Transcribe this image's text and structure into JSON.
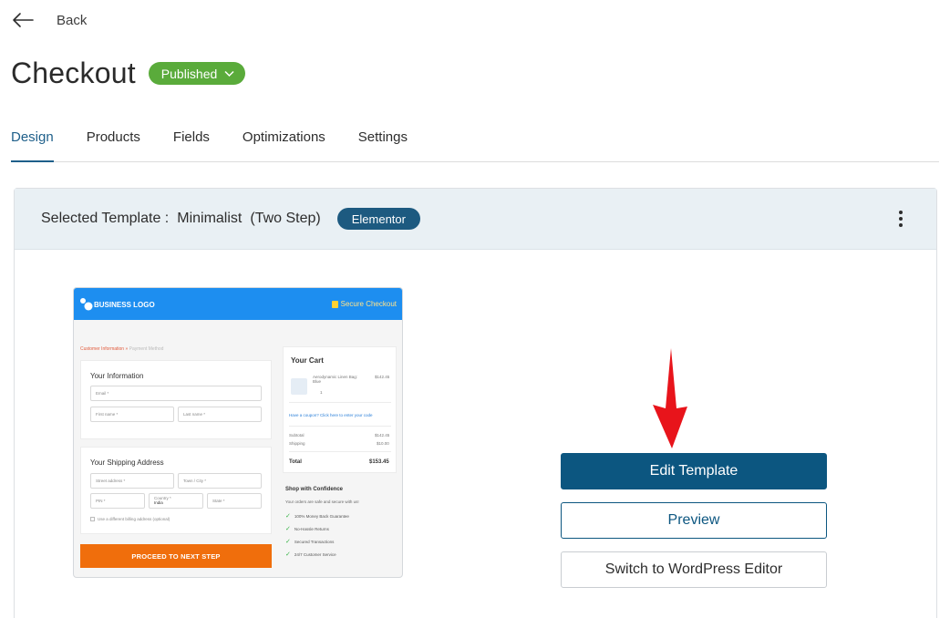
{
  "nav": {
    "back_label": "Back",
    "back_icon": "arrow-left-icon"
  },
  "page": {
    "title": "Checkout",
    "status": "Published",
    "status_color": "#5aab3b"
  },
  "tabs": [
    {
      "label": "Design",
      "active": true
    },
    {
      "label": "Products",
      "active": false
    },
    {
      "label": "Fields",
      "active": false
    },
    {
      "label": "Optimizations",
      "active": false
    },
    {
      "label": "Settings",
      "active": false
    }
  ],
  "template_card": {
    "selected_label": "Selected Template :",
    "template_name": "Minimalist",
    "template_variant": "(Two Step)",
    "builder_badge": "Elementor",
    "menu_icon": "kebab-menu-icon"
  },
  "thumbnail": {
    "logo": "BUSINESS LOGO",
    "secure": "Secure Checkout",
    "breadcrumb_current": "Customer Information",
    "breadcrumb_sep": "»",
    "breadcrumb_next": "Payment Method",
    "info_title": "Your Information",
    "email": "Email *",
    "first_name": "First name *",
    "last_name": "Last name *",
    "shipping_title": "Your Shipping Address",
    "street": "Street address *",
    "town": "Town / City *",
    "pin": "PIN *",
    "country_label": "Country *",
    "country": "India",
    "state": "State *",
    "billing_check": "Use a different billing address (optional)",
    "proceed": "PROCEED TO NEXT STEP",
    "cart_title": "Your Cart",
    "product_name": "Aerodynamic Linen Bag: Blue",
    "product_price": "$142.45",
    "qty": "1",
    "coupon": "Have a coupon? Click here to enter your code",
    "subtotal_label": "Subtotal",
    "subtotal": "$142.45",
    "shipping_label": "Shipping",
    "shipping": "$10.00",
    "total_label": "Total",
    "total": "$153.45",
    "confidence_title": "Shop with Confidence",
    "confidence_sub": "Your orders are safe and secure with us!",
    "guarantees": [
      "100% Money Back Guarantee",
      "No-Hassle Returns",
      "Secured Transactions",
      "24/7 Customer Service"
    ]
  },
  "actions": {
    "edit": "Edit Template",
    "preview": "Preview",
    "switch": "Switch to WordPress Editor"
  },
  "colors": {
    "primary": "#0c5680",
    "accent_arrow": "#e8141b",
    "header_bg": "#e9f0f4"
  }
}
